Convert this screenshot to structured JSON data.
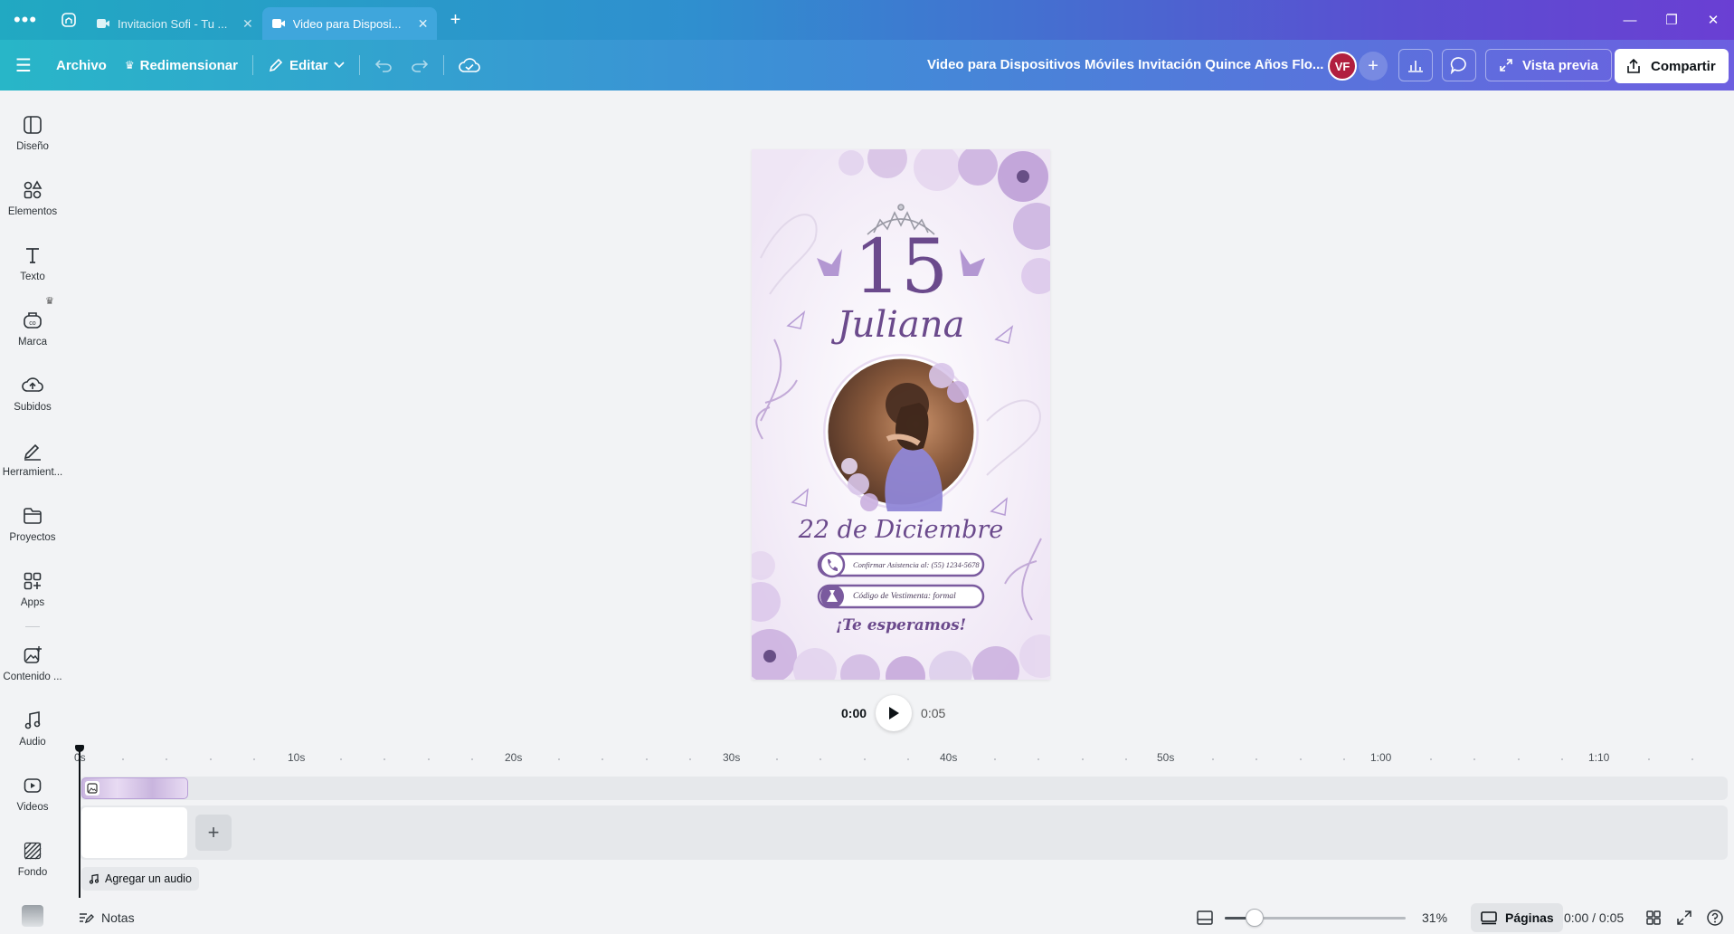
{
  "tabs": [
    {
      "label": "Invitacion Sofi - Tu ...",
      "active": false
    },
    {
      "label": "Video para Disposi...",
      "active": true
    }
  ],
  "toolbar": {
    "archivo": "Archivo",
    "redimensionar": "Redimensionar",
    "editar": "Editar",
    "doc_title": "Video para Dispositivos Móviles Invitación Quince Años Flo...",
    "avatar_initials": "VF",
    "vista_previa": "Vista previa",
    "compartir": "Compartir"
  },
  "sidebar": {
    "items": [
      {
        "label": "Diseño",
        "icon": "layout-icon"
      },
      {
        "label": "Elementos",
        "icon": "elements-icon"
      },
      {
        "label": "Texto",
        "icon": "text-icon"
      },
      {
        "label": "Marca",
        "icon": "brand-icon"
      },
      {
        "label": "Subidos",
        "icon": "upload-icon"
      },
      {
        "label": "Herramient...",
        "icon": "tools-icon"
      },
      {
        "label": "Proyectos",
        "icon": "folder-icon"
      },
      {
        "label": "Apps",
        "icon": "apps-icon"
      },
      {
        "label": "Contenido ...",
        "icon": "media-icon"
      },
      {
        "label": "Audio",
        "icon": "music-icon"
      },
      {
        "label": "Videos",
        "icon": "video-icon"
      },
      {
        "label": "Fondo",
        "icon": "background-icon"
      }
    ]
  },
  "design": {
    "number": "15",
    "name": "Juliana",
    "date": "22 de Diciembre",
    "rsvp": "Confirmar Asistencia al: (55) 1234-5678",
    "dress_code": "Código de Vestimenta: formal",
    "closing": "¡Te esperamos!"
  },
  "playback": {
    "current": "0:00",
    "duration": "0:05"
  },
  "timeline": {
    "ticks": [
      "0s",
      "10s",
      "20s",
      "30s",
      "40s",
      "50s",
      "1:00",
      "1:10"
    ],
    "add_audio": "Agregar un audio"
  },
  "status": {
    "notes": "Notas",
    "zoom": "31%",
    "zoom_value": 31,
    "pages": "Páginas",
    "time": "0:00 / 0:05"
  },
  "colors": {
    "accent_purple": "#6b4a8c",
    "gradient_start": "#28b6c8",
    "gradient_end": "#6d5fe0"
  }
}
